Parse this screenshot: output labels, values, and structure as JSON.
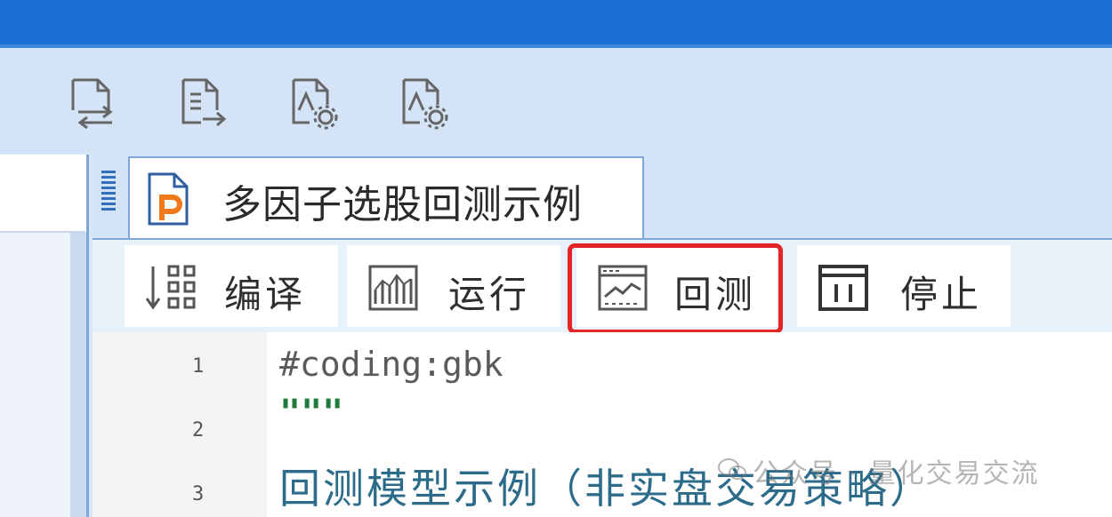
{
  "toolbar": {
    "buttons": [
      {
        "icon": "file-transfer-icon"
      },
      {
        "icon": "file-export-icon"
      },
      {
        "icon": "file-settings-icon"
      },
      {
        "icon": "file-settings-icon-2"
      }
    ]
  },
  "tab": {
    "title": "多因子选股回测示例",
    "icon": "python-file-icon"
  },
  "actions": {
    "compile": "编译",
    "run": "运行",
    "backtest": "回测",
    "stop": "停止"
  },
  "editor": {
    "lines": [
      {
        "no": "1",
        "text": "#coding:gbk"
      },
      {
        "no": "2",
        "text": "\"\"\""
      },
      {
        "no": "3",
        "text": "回测模型示例（非实盘交易策略）"
      }
    ]
  },
  "watermark": "公众号 · 量化交易交流",
  "colors": {
    "titlebar": "#1a70d4",
    "highlight": "#e32525",
    "toolbar_bg": "#d4e4f6"
  }
}
